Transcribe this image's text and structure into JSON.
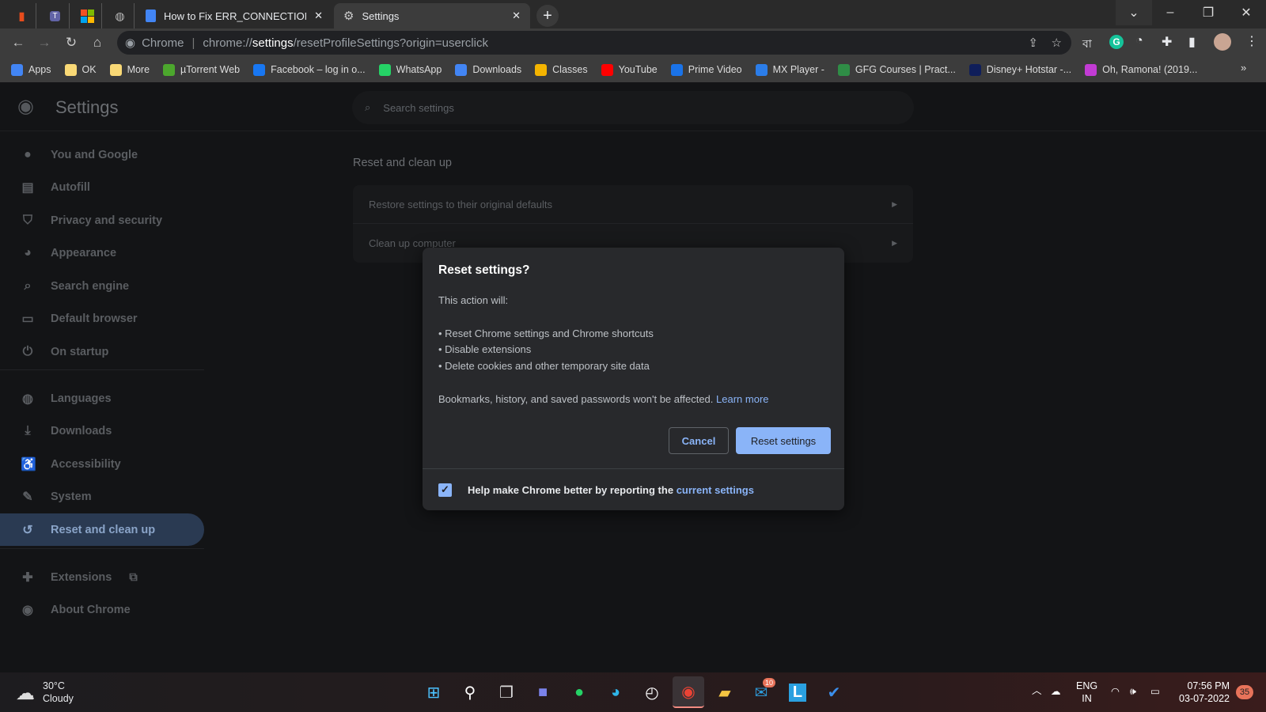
{
  "browser": {
    "pinned_tabs": [
      {
        "icon": "office-icon",
        "color": "#e74c1c"
      },
      {
        "icon": "teams-icon",
        "color": "#6264a7"
      },
      {
        "icon": "microsoft-icon",
        "color": "#f25022"
      },
      {
        "icon": "globe-icon",
        "color": "#bbbbbb"
      }
    ],
    "tabs": [
      {
        "title": "How to Fix ERR_CONNECTION_R",
        "icon": "docs-icon",
        "active": false
      },
      {
        "title": "Settings",
        "icon": "gear-icon",
        "active": true
      }
    ],
    "url": {
      "site_label": "Chrome",
      "scheme": "chrome://",
      "host": "settings",
      "path": "/resetProfileSettings?origin=userclick"
    },
    "bookmarks": [
      {
        "label": "Apps",
        "icon": "apps-grid-icon",
        "color": "#4285f4"
      },
      {
        "label": "OK",
        "icon": "folder-icon",
        "color": "#f9d976"
      },
      {
        "label": "More",
        "icon": "folder-icon",
        "color": "#f9d976"
      },
      {
        "label": "µTorrent Web",
        "icon": "utorrent-icon",
        "color": "#4ca72d"
      },
      {
        "label": "Facebook – log in o...",
        "icon": "facebook-icon",
        "color": "#1877f2"
      },
      {
        "label": "WhatsApp",
        "icon": "whatsapp-icon",
        "color": "#25d366"
      },
      {
        "label": "Downloads",
        "icon": "download-icon",
        "color": "#4285f4"
      },
      {
        "label": "Classes",
        "icon": "classroom-icon",
        "color": "#f4b400"
      },
      {
        "label": "YouTube",
        "icon": "youtube-icon",
        "color": "#ff0000"
      },
      {
        "label": "Prime Video",
        "icon": "play-icon",
        "color": "#1a73e8"
      },
      {
        "label": "MX Player -",
        "icon": "play-icon",
        "color": "#2b7de9"
      },
      {
        "label": "GFG Courses | Pract...",
        "icon": "gfg-icon",
        "color": "#2f8d46"
      },
      {
        "label": "Disney+ Hotstar -...",
        "icon": "hotstar-icon",
        "color": "#0f1e5a"
      },
      {
        "label": "Oh, Ramona! (2019...",
        "icon": "m-icon",
        "color": "#c23bd4"
      }
    ],
    "more_bookmarks": "»",
    "extension_text": "বা"
  },
  "settings": {
    "title": "Settings",
    "search_placeholder": "Search settings",
    "nav": [
      {
        "label": "You and Google",
        "icon": "person-icon"
      },
      {
        "label": "Autofill",
        "icon": "clipboard-icon"
      },
      {
        "label": "Privacy and security",
        "icon": "shield-icon"
      },
      {
        "label": "Appearance",
        "icon": "palette-icon"
      },
      {
        "label": "Search engine",
        "icon": "search-icon"
      },
      {
        "label": "Default browser",
        "icon": "browser-icon"
      },
      {
        "label": "On startup",
        "icon": "power-icon"
      },
      {
        "label": "Languages",
        "icon": "globe-icon"
      },
      {
        "label": "Downloads",
        "icon": "download-icon"
      },
      {
        "label": "Accessibility",
        "icon": "accessibility-icon"
      },
      {
        "label": "System",
        "icon": "wrench-icon"
      },
      {
        "label": "Reset and clean up",
        "icon": "history-icon",
        "selected": true
      },
      {
        "label": "Extensions",
        "icon": "puzzle-icon"
      },
      {
        "label": "About Chrome",
        "icon": "chrome-icon"
      }
    ],
    "section_title": "Reset and clean up",
    "rows": [
      "Restore settings to their original defaults",
      "Clean up computer"
    ]
  },
  "dialog": {
    "title": "Reset settings?",
    "intro": "This action will:",
    "bullets": [
      "• Reset Chrome settings and Chrome shortcuts",
      "• Disable extensions",
      "• Delete cookies and other temporary site data"
    ],
    "note": "Bookmarks, history, and saved passwords won't be affected.",
    "learn_more": "Learn more",
    "cancel": "Cancel",
    "confirm": "Reset settings",
    "checkbox_checked": true,
    "checkbox_label": "Help make Chrome better by reporting the",
    "checkbox_link": "current settings",
    "accent": "#8ab4f8"
  },
  "taskbar": {
    "weather_temp": "30°C",
    "weather_desc": "Cloudy",
    "mail_badge": "10",
    "lang_1": "ENG",
    "lang_2": "IN",
    "time": "07:56 PM",
    "date": "03-07-2022",
    "notif_count": "35"
  }
}
